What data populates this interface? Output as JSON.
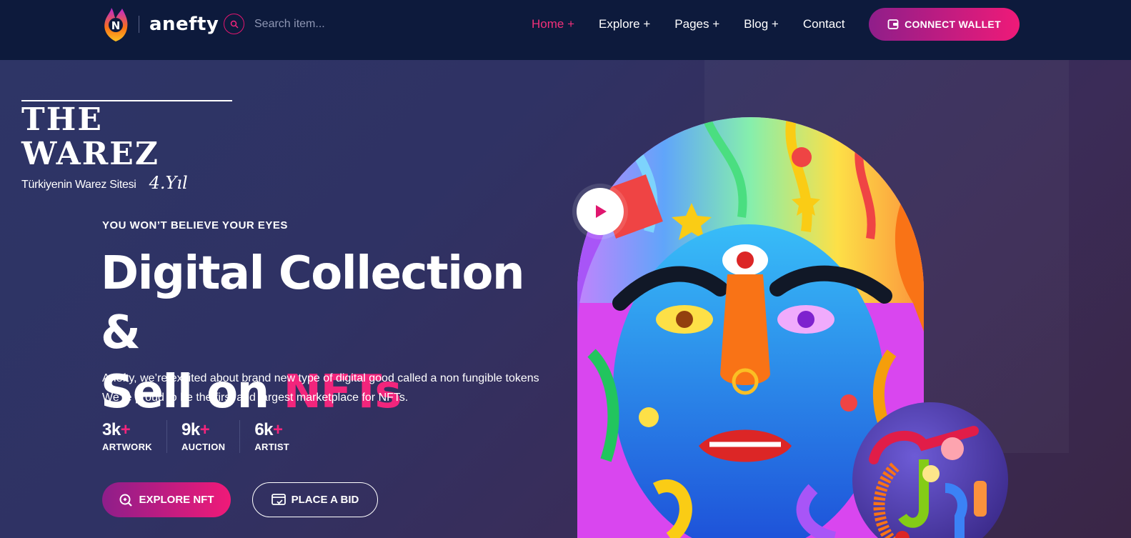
{
  "header": {
    "logo_text": "anefty",
    "search_placeholder": "Search item...",
    "nav": [
      {
        "label": "Home +",
        "active": true
      },
      {
        "label": "Explore +"
      },
      {
        "label": "Pages +"
      },
      {
        "label": "Blog +"
      },
      {
        "label": "Contact"
      }
    ],
    "connect_wallet_label": "CONNECT WALLET"
  },
  "overlay_logo": {
    "title": "THE WAREZ",
    "tagline": "Türkiyenin Warez Sitesi",
    "year": "4.Yıl"
  },
  "hero": {
    "eyebrow": "YOU WON’T BELIEVE YOUR EYES",
    "headline_line1": "Digital Collection &",
    "headline_line2_prefix": "Sell on ",
    "headline_highlight": "NFTs",
    "description_line1": "Anefty, we’re excited about brand new type of digital good called a non fungible tokens",
    "description_line2": "We’re proud to be the first and largest marketplace for NFTs.",
    "stats": [
      {
        "number": "3k",
        "plus": "+",
        "label": "ARTWORK"
      },
      {
        "number": "9k",
        "plus": "+",
        "label": "AUCTION"
      },
      {
        "number": "6k",
        "plus": "+",
        "label": "ARTIST"
      }
    ],
    "explore_label": "EXPLORE NFT",
    "bid_label": "PLACE A BID"
  },
  "colors": {
    "topbar": "#0d1a3c",
    "accent_pink": "#f2257c",
    "gradient_purple": "#8f1e8a"
  }
}
